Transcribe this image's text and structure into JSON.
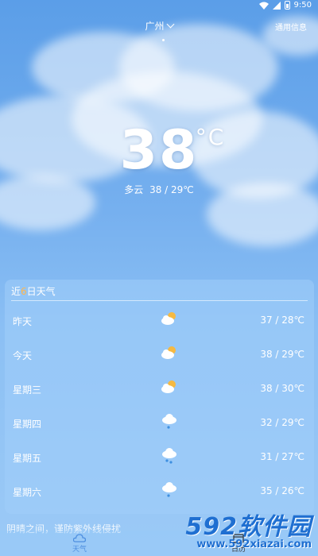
{
  "status": {
    "time": "9:50"
  },
  "header": {
    "city": "广州",
    "info_link": "通用信息"
  },
  "current": {
    "temp": "38",
    "unit": "°C",
    "condition": "多云",
    "range": "38 / 29℃"
  },
  "forecast": {
    "title_prefix": "近",
    "title_number": "6",
    "title_suffix": "日天气",
    "days": [
      {
        "day": "昨天",
        "icon": "partly-cloudy-icon",
        "range": "37 / 28℃"
      },
      {
        "day": "今天",
        "icon": "partly-cloudy-icon",
        "range": "38 / 29℃"
      },
      {
        "day": "星期三",
        "icon": "partly-cloudy-icon",
        "range": "38 / 30℃"
      },
      {
        "day": "星期四",
        "icon": "light-rain-icon",
        "range": "32 / 29℃"
      },
      {
        "day": "星期五",
        "icon": "rain-icon",
        "range": "31 / 27℃"
      },
      {
        "day": "星期六",
        "icon": "light-rain-icon",
        "range": "35 / 26℃"
      }
    ]
  },
  "tip": "阴晴之间，谨防紫外线侵扰",
  "nav": [
    {
      "label": "天气",
      "icon": "weather-icon",
      "active": true
    },
    {
      "label": "日历",
      "icon": "calendar-icon",
      "active": false
    }
  ],
  "watermark": {
    "main": "592软件园",
    "url": "www.592xiazai.com"
  },
  "colors": {
    "accent": "#4e8fe0",
    "highlight": "#ffb74d",
    "sun": "#f5b942"
  }
}
